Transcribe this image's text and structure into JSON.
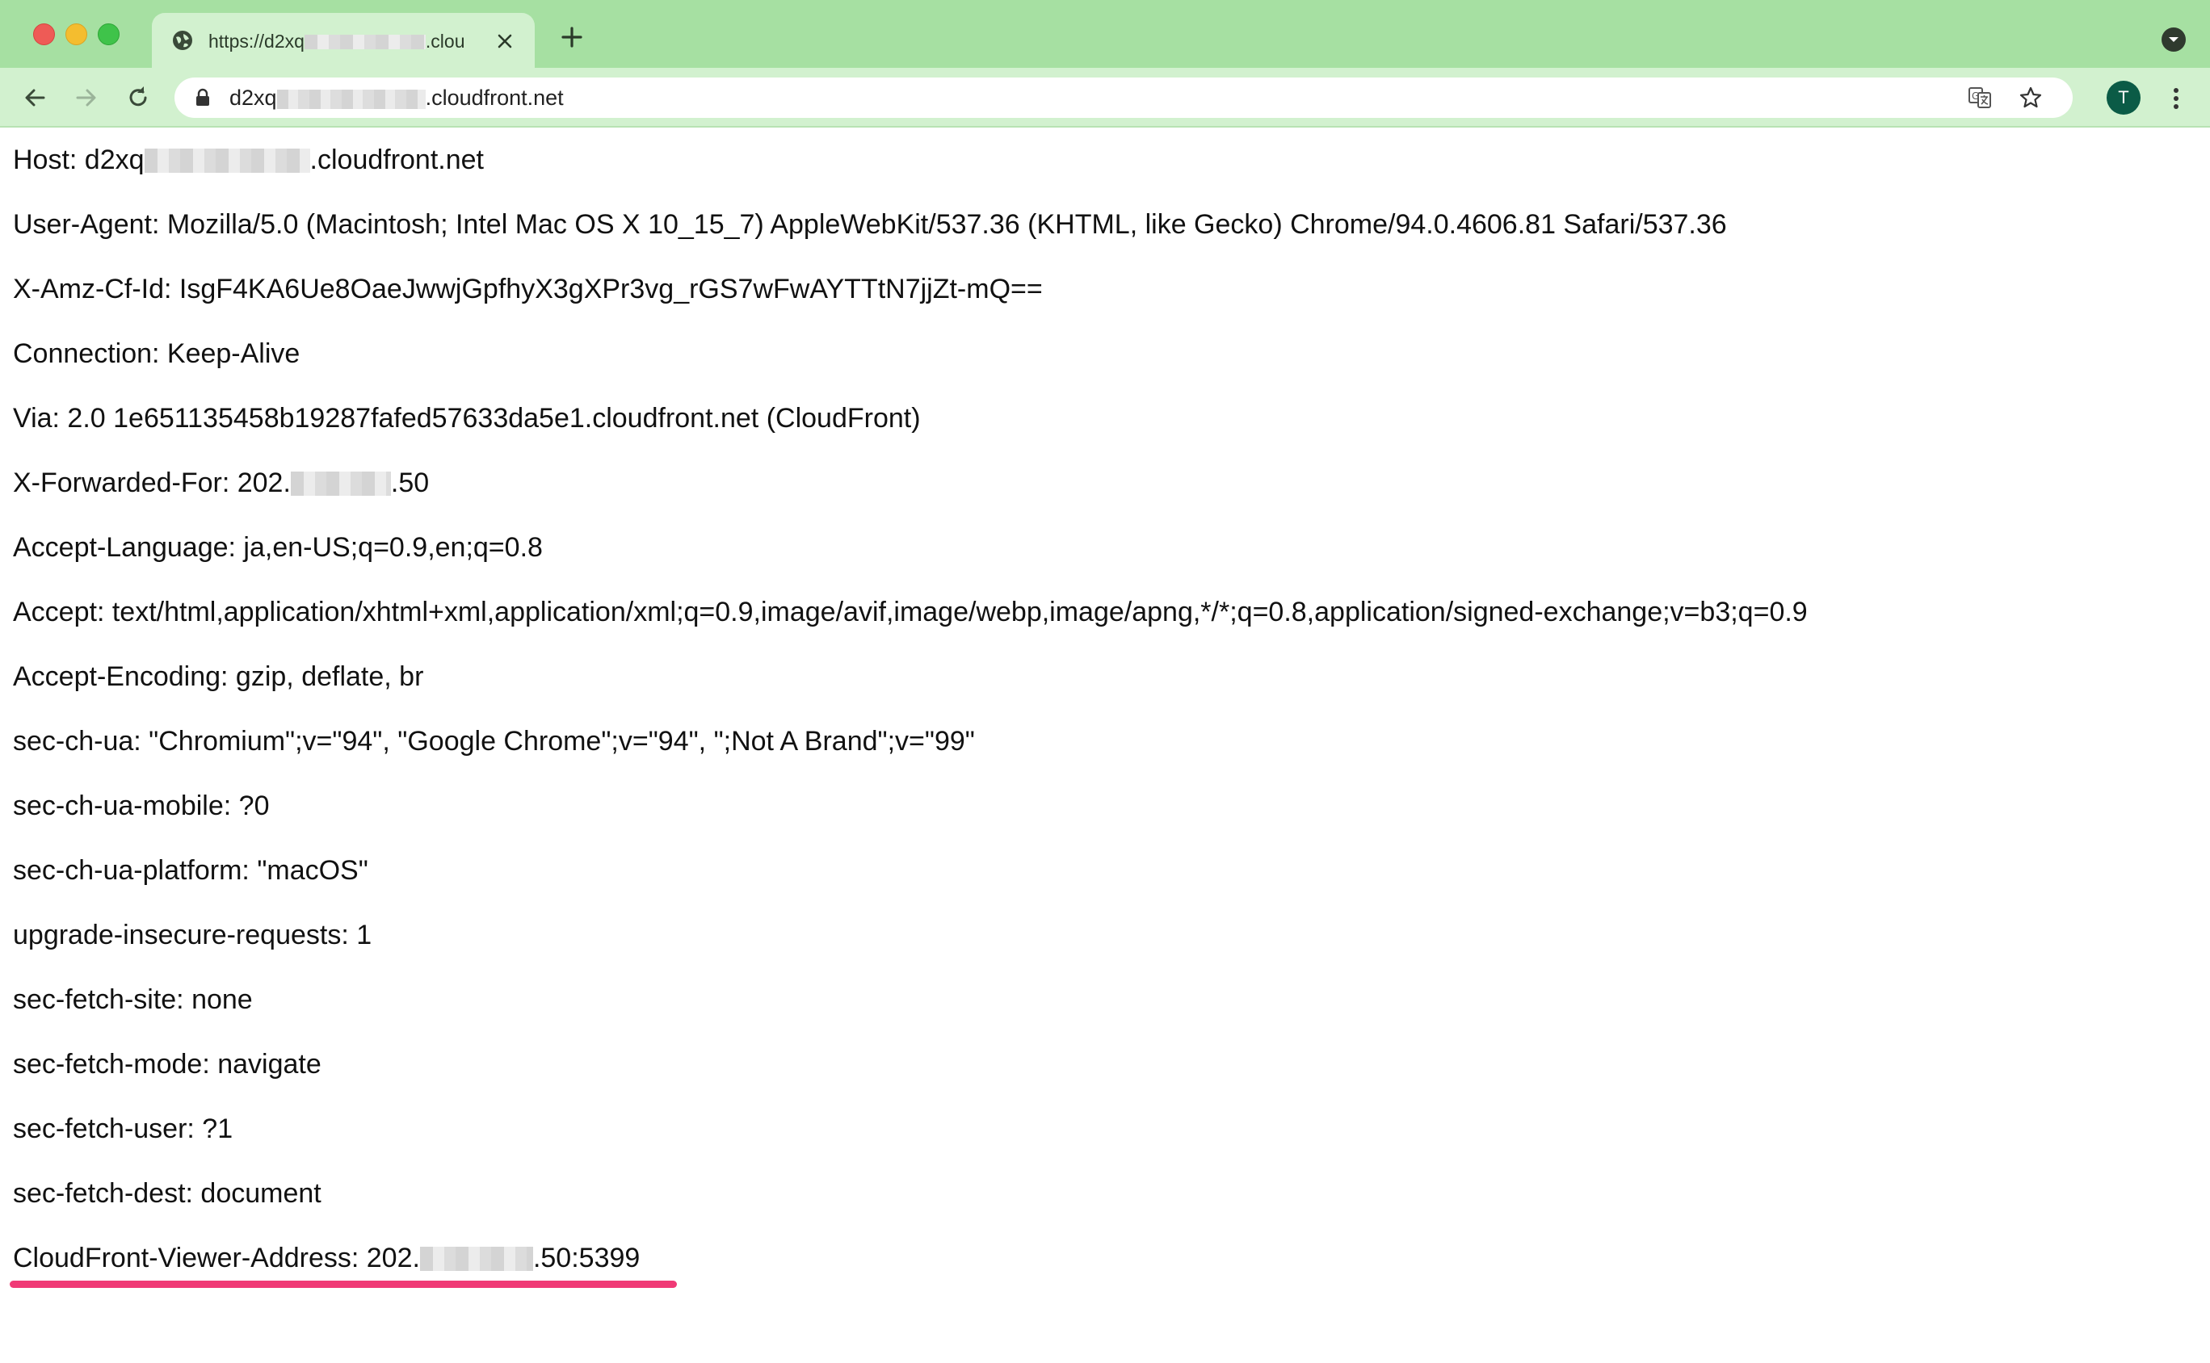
{
  "browser": {
    "tab": {
      "title": "https://d2xq",
      "title_suffix": ".clou"
    },
    "address": {
      "prefix": "d2xq",
      "suffix": ".cloudfront.net"
    },
    "avatar_letter": "T",
    "icons": {
      "favicon": "globe-icon",
      "tab_close": "close-icon",
      "new_tab": "plus-icon",
      "tab_search": "chevron-down-icon",
      "back": "arrow-left-icon",
      "forward": "arrow-right-icon",
      "reload": "reload-icon",
      "lock": "lock-icon",
      "translate": "translate-icon",
      "bookmark": "star-icon",
      "menu": "kebab-menu-icon"
    }
  },
  "headers": [
    {
      "before": "Host: d2xq",
      "redacted": true,
      "after": ".cloudfront.net"
    },
    {
      "before": "User-Agent: Mozilla/5.0 (Macintosh; Intel Mac OS X 10_15_7) AppleWebKit/537.36 (KHTML, like Gecko) Chrome/94.0.4606.81 Safari/537.36",
      "redacted": false,
      "after": ""
    },
    {
      "before": "X-Amz-Cf-Id: IsgF4KA6Ue8OaeJwwjGpfhyX3gXPr3vg_rGS7wFwAYTTtN7jjZt-mQ==",
      "redacted": false,
      "after": ""
    },
    {
      "before": "Connection: Keep-Alive",
      "redacted": false,
      "after": ""
    },
    {
      "before": "Via: 2.0 1e651135458b19287fafed57633da5e1.cloudfront.net (CloudFront)",
      "redacted": false,
      "after": ""
    },
    {
      "before": "X-Forwarded-For: 202.",
      "redacted": true,
      "after": ".50"
    },
    {
      "before": "Accept-Language: ja,en-US;q=0.9,en;q=0.8",
      "redacted": false,
      "after": ""
    },
    {
      "before": "Accept: text/html,application/xhtml+xml,application/xml;q=0.9,image/avif,image/webp,image/apng,*/*;q=0.8,application/signed-exchange;v=b3;q=0.9",
      "redacted": false,
      "after": ""
    },
    {
      "before": "Accept-Encoding: gzip, deflate, br",
      "redacted": false,
      "after": ""
    },
    {
      "before": "sec-ch-ua: \"Chromium\";v=\"94\", \"Google Chrome\";v=\"94\", \";Not A Brand\";v=\"99\"",
      "redacted": false,
      "after": ""
    },
    {
      "before": "sec-ch-ua-mobile: ?0",
      "redacted": false,
      "after": ""
    },
    {
      "before": "sec-ch-ua-platform: \"macOS\"",
      "redacted": false,
      "after": ""
    },
    {
      "before": "upgrade-insecure-requests: 1",
      "redacted": false,
      "after": ""
    },
    {
      "before": "sec-fetch-site: none",
      "redacted": false,
      "after": ""
    },
    {
      "before": "sec-fetch-mode: navigate",
      "redacted": false,
      "after": ""
    },
    {
      "before": "sec-fetch-user: ?1",
      "redacted": false,
      "after": ""
    },
    {
      "before": "sec-fetch-dest: document",
      "redacted": false,
      "after": ""
    },
    {
      "before": "CloudFront-Viewer-Address: 202.",
      "redacted": true,
      "after": ".50:5399"
    }
  ],
  "highlight_color": "#f03a76"
}
